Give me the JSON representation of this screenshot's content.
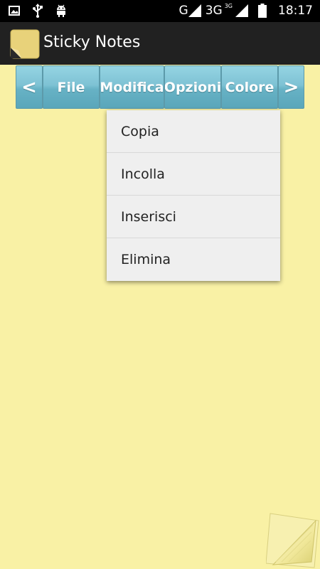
{
  "status_bar": {
    "network_type": "G",
    "network_type_2": "3G",
    "network_type_2_small": "3G",
    "time": "18:17",
    "icons_left": [
      "image-icon",
      "usb-icon",
      "android-icon"
    ],
    "icons_right": [
      "signal-icon",
      "signal-icon",
      "battery-icon"
    ]
  },
  "action_bar": {
    "title": "Sticky Notes",
    "icon": "sticky-note-icon"
  },
  "toolbar": {
    "prev_label": "<",
    "file_label": "File",
    "modifica_label": "Modifica",
    "opzioni_label": "Opzioni",
    "colore_label": "Colore",
    "next_label": ">"
  },
  "dropdown": {
    "items": [
      {
        "label": "Copia"
      },
      {
        "label": "Incolla"
      },
      {
        "label": "Inserisci"
      },
      {
        "label": "Elimina"
      }
    ]
  },
  "colors": {
    "note_background": "#f9f1a5",
    "action_bar": "#212121",
    "toolbar_button": "#7ec2d4",
    "dropdown_background": "#efefef"
  }
}
